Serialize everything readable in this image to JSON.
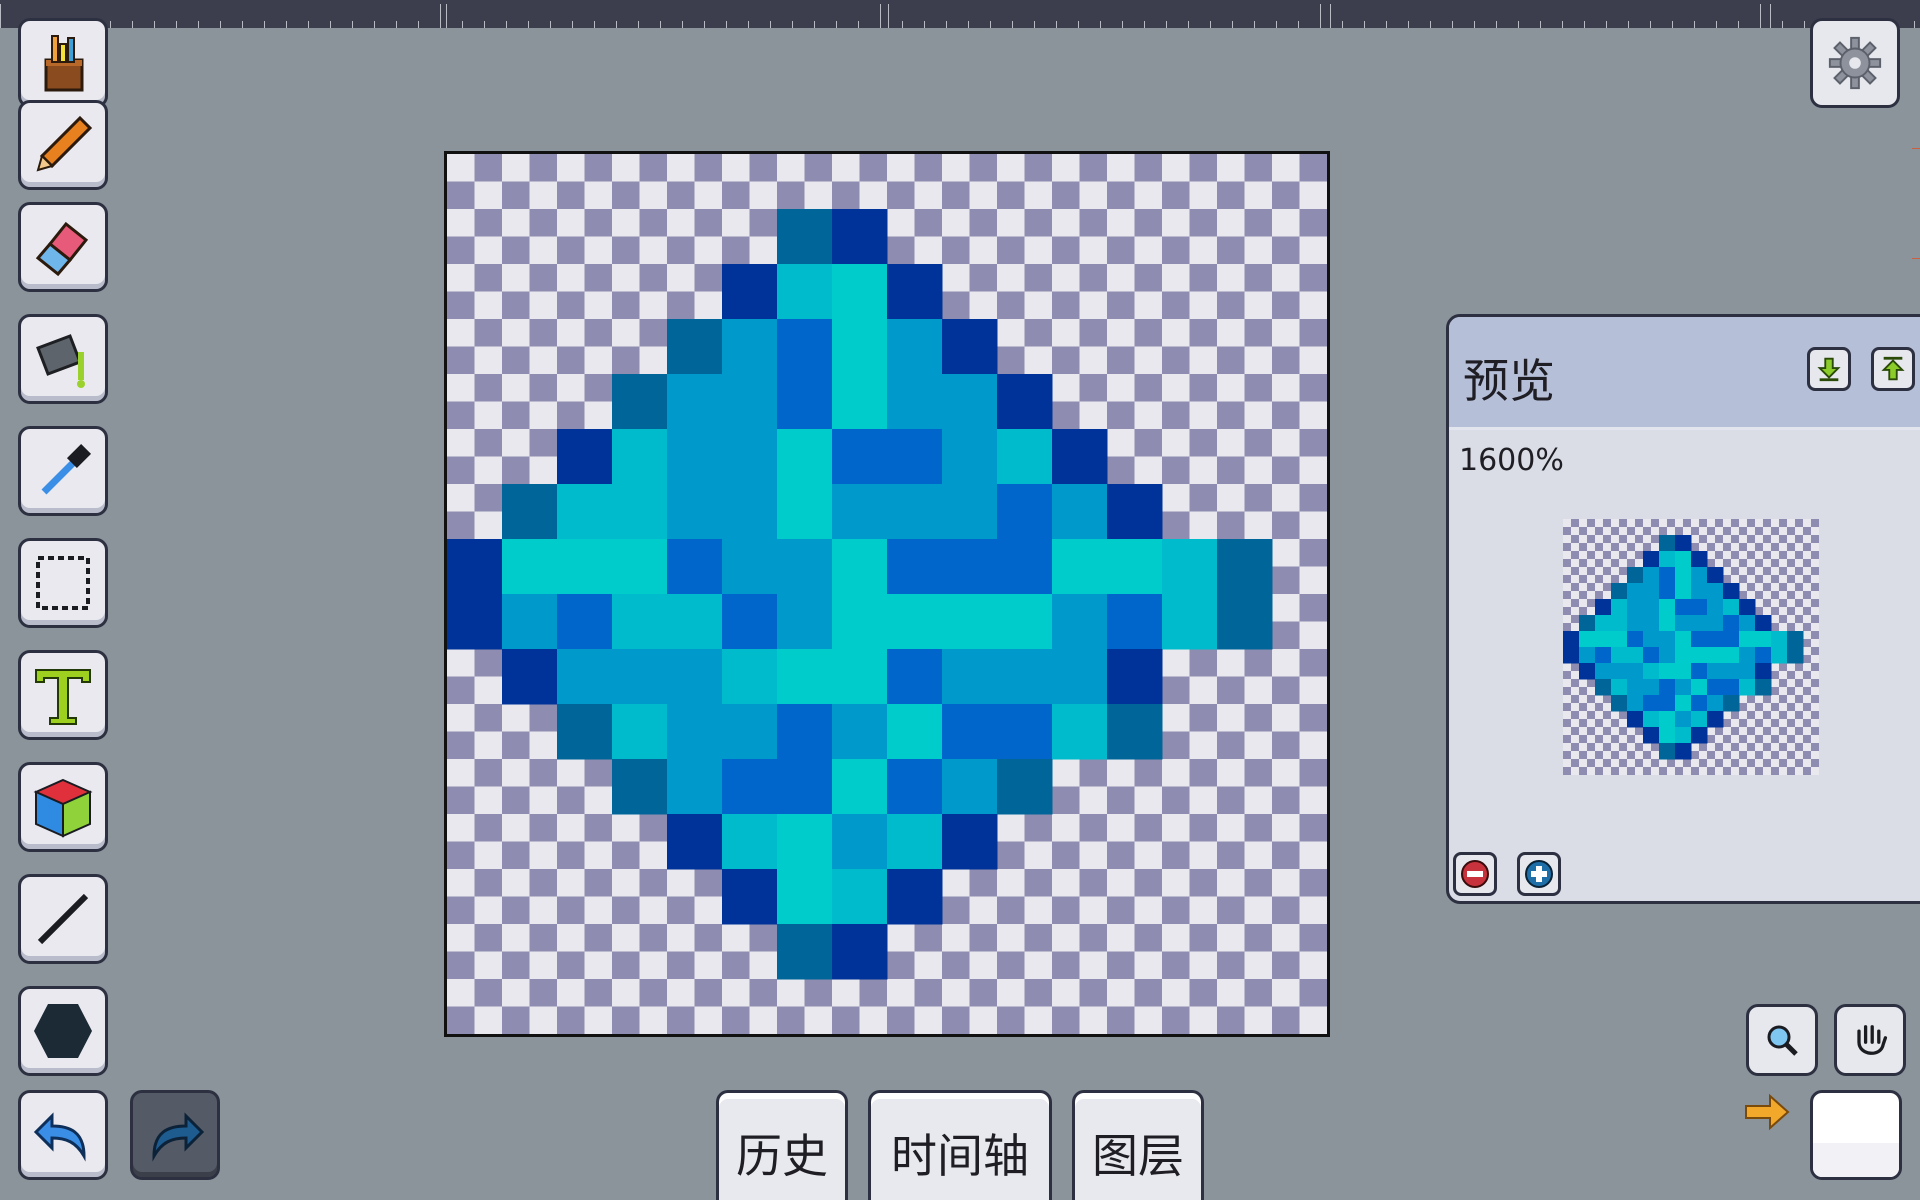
{
  "app": {
    "tools": [
      {
        "name": "brush-set-tool",
        "icon": "paint-brushes-cup-icon"
      },
      {
        "name": "pencil-tool",
        "icon": "pencil-icon"
      },
      {
        "name": "eraser-tool",
        "icon": "eraser-icon"
      },
      {
        "name": "fill-bucket-tool",
        "icon": "paint-bucket-icon"
      },
      {
        "name": "eyedropper-tool",
        "icon": "eyedropper-icon"
      },
      {
        "name": "select-tool",
        "icon": "dashed-rectangle-icon"
      },
      {
        "name": "text-tool",
        "icon": "text-t-icon"
      },
      {
        "name": "3d-cube-tool",
        "icon": "cube-icon"
      },
      {
        "name": "line-tool",
        "icon": "line-icon"
      },
      {
        "name": "shape-tool",
        "icon": "hexagon-icon"
      }
    ],
    "undo_icon": "undo-arrow-icon",
    "redo_icon": "redo-arrow-icon",
    "settings_icon": "gear-icon"
  },
  "bottom_tabs": {
    "history": "历史",
    "timeline": "时间轴",
    "layers": "图层"
  },
  "preview": {
    "title": "预览",
    "zoom": "1600%",
    "dock_down_icon": "arrow-down-icon",
    "dock_up_icon": "arrow-up-icon",
    "zoom_out_icon": "minus-icon",
    "zoom_in_icon": "plus-icon"
  },
  "canvas": {
    "grid_size": 16,
    "palette": {
      "A": "#003399",
      "B": "#006699",
      "C": "#0066CC",
      "D": "#0099CC",
      "E": "#00BBCC",
      "F": "#00CCCC"
    },
    "pixels": [
      "................",
      "......BA........",
      ".....AEFA.......",
      "....BDCFDA......",
      "...BDDCFDDA.....",
      "..AEDDFCCDEA....",
      ".BEEDDFDDDCDA...",
      "AFFFCDDFCCCFFEB.",
      "ADCEECDFFFFDCEB.",
      ".ADDDEFFCDDDA...",
      "..BEDDCDFCCEB...",
      "...BDCCFCDB.....",
      "....AEFDEA......",
      ".....AFEA.......",
      "......BA........",
      "................"
    ]
  },
  "colors": {
    "primary_swatch": "#FFFFFF",
    "swap_arrow_color": "#F2A92B"
  }
}
